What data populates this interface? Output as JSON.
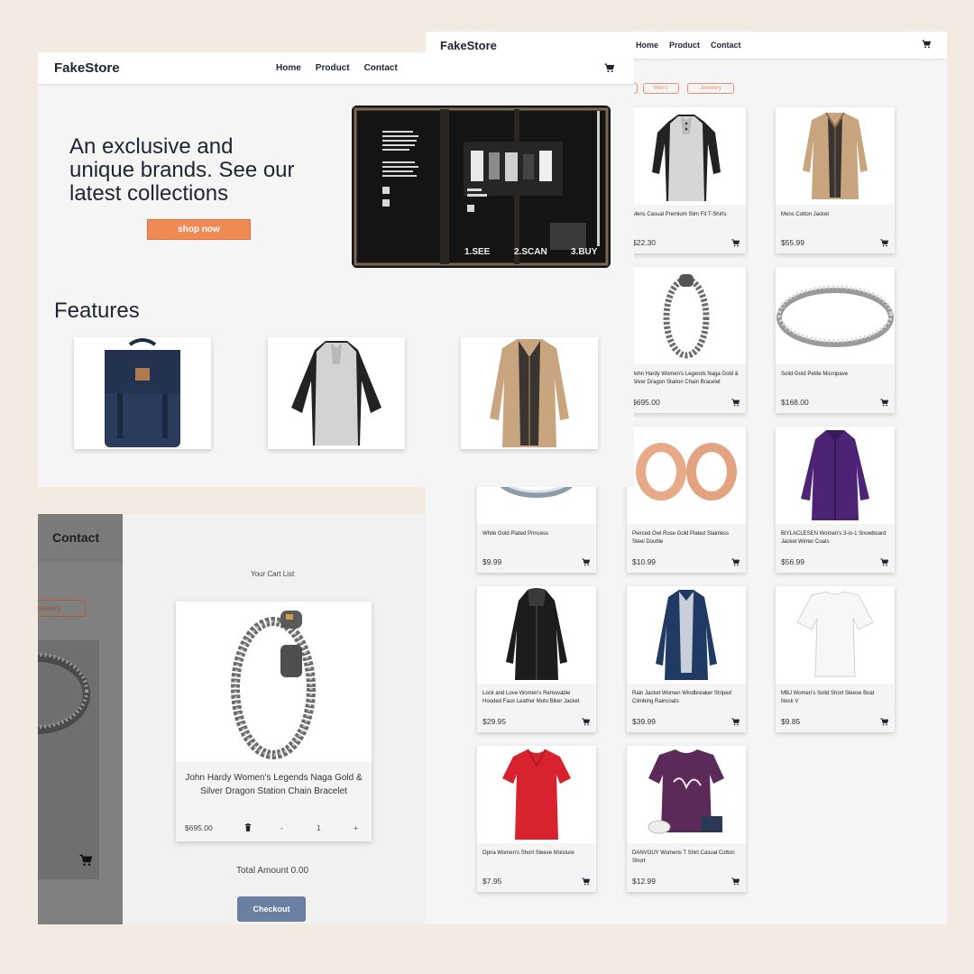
{
  "products_page": {
    "brand": "FakeStore",
    "nav": [
      "Home",
      "Product",
      "Contact"
    ],
    "filters": [
      "",
      "Men's",
      "Jewelery"
    ],
    "products": [
      {
        "title": "Mens Casual Premium Slim Fit T-Shirts",
        "price": "$22.30"
      },
      {
        "title": "Mens Cotton Jacket",
        "price": "$55.99"
      },
      {
        "title": "John Hardy Women's Legends Naga Gold & Silver Dragon Station Chain Bracelet",
        "price": "$695.00"
      },
      {
        "title": "Solid Gold Petite Micropave",
        "price": "$168.00"
      },
      {
        "title": "White Gold Plated Princess",
        "price": "$9.99"
      },
      {
        "title": "Pierced Owl Rose Gold Plated Stainless Steel Double",
        "price": "$10.99"
      },
      {
        "title": "BIYLACLESEN Women's 3-in-1 Snowboard Jacket Winter Coats",
        "price": "$56.99"
      },
      {
        "title": "Lock and Love Women's Removable Hooded Faux Leather Moto Biker Jacket",
        "price": "$29.95"
      },
      {
        "title": "Rain Jacket Women Windbreaker Striped Climbing Raincoats",
        "price": "$39.99"
      },
      {
        "title": "MBJ Women's Solid Short Sleeve Boat Neck V",
        "price": "$9.85"
      },
      {
        "title": "Opna Women's Short Sleeve Moisture",
        "price": "$7.95"
      },
      {
        "title": "DANVOUY Womens T Shirt Casual Cotton Short",
        "price": "$12.99"
      }
    ]
  },
  "home_page": {
    "brand": "FakeStore",
    "nav": [
      "Home",
      "Product",
      "Contact"
    ],
    "hero_text": "An exclusive and unique brands. See our latest collections",
    "shop_button": "shop now",
    "features_title": "Features",
    "storefront_text": [
      "1.SEE",
      "2.SCAN",
      "3.BUY"
    ]
  },
  "cart_page": {
    "side_contact": "Contact",
    "side_filter": "Jewelery",
    "title": "Your Cart List",
    "item": {
      "title": "John Hardy Women's Legends Naga Gold & Silver Dragon Station Chain Bracelet",
      "price": "$695.00",
      "minus": "-",
      "quantity": "1",
      "plus": "+"
    },
    "total": "Total Amount  0.00",
    "checkout": "Checkout"
  },
  "colors": {
    "accent": "#ef8a54",
    "checkout": "#6b7fa2",
    "text": "#1f2433",
    "background": "#f3ebe1"
  },
  "icons": [
    "cart-icon",
    "trash-icon"
  ]
}
